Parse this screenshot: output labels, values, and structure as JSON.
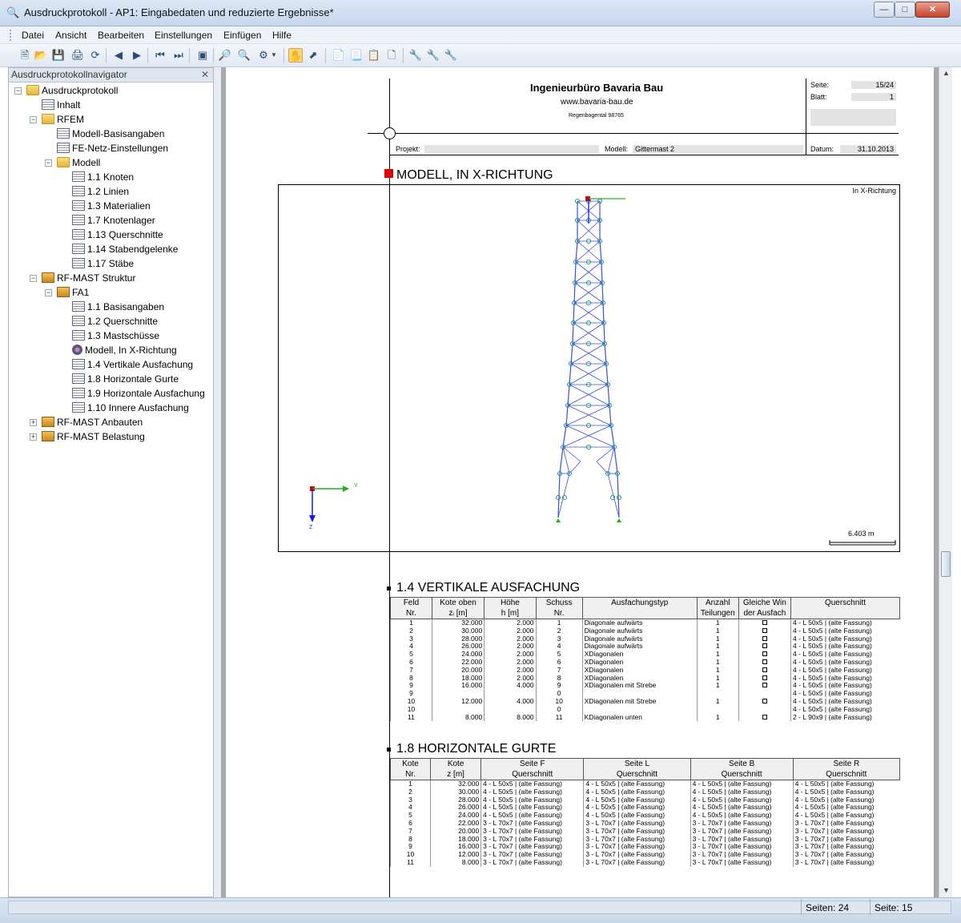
{
  "window": {
    "title": "Ausdruckprotokoll - AP1: Eingabedaten und reduzierte Ergebnisse*",
    "minimize": "—",
    "maximize": "□",
    "close": "✕"
  },
  "menu": [
    "Datei",
    "Ansicht",
    "Bearbeiten",
    "Einstellungen",
    "Einfügen",
    "Hilfe"
  ],
  "navigator": {
    "title": "Ausdruckprotokollnavigator",
    "close": "✕",
    "items": [
      {
        "label": "Ausdruckprotokoll",
        "icon": "folder-icon",
        "expander": "−"
      },
      {
        "label": "Inhalt",
        "icon": "table-icon"
      },
      {
        "label": "RFEM",
        "icon": "folder-icon",
        "expander": "−"
      },
      {
        "label": "Modell-Basisangaben",
        "icon": "table-icon"
      },
      {
        "label": "FE-Netz-Einstellungen",
        "icon": "table-icon"
      },
      {
        "label": "Modell",
        "icon": "folder-icon",
        "expander": "−"
      },
      {
        "label": "1.1 Knoten",
        "icon": "table-icon"
      },
      {
        "label": "1.2 Linien",
        "icon": "table-icon"
      },
      {
        "label": "1.3 Materialien",
        "icon": "table-icon"
      },
      {
        "label": "1.7 Knotenlager",
        "icon": "table-icon"
      },
      {
        "label": "1.13 Querschnitte",
        "icon": "table-icon"
      },
      {
        "label": "1.14 Stabendgelenke",
        "icon": "table-icon"
      },
      {
        "label": "1.17 Stäbe",
        "icon": "table-icon"
      },
      {
        "label": "RF-MAST Struktur",
        "icon": "mast-icon",
        "expander": "−"
      },
      {
        "label": "FA1",
        "icon": "mast-icon",
        "expander": "−"
      },
      {
        "label": "1.1 Basisangaben",
        "icon": "table-icon"
      },
      {
        "label": "1.2 Querschnitte",
        "icon": "table-icon"
      },
      {
        "label": "1.3 Mastschüsse",
        "icon": "table-icon"
      },
      {
        "label": "Modell, In X-Richtung",
        "icon": "model-icon"
      },
      {
        "label": "1.4 Vertikale Ausfachung",
        "icon": "table-icon"
      },
      {
        "label": "1.8 Horizontale Gurte",
        "icon": "table-icon"
      },
      {
        "label": "1.9 Horizontale Ausfachung",
        "icon": "table-icon"
      },
      {
        "label": "1.10 Innere Ausfachung",
        "icon": "table-icon"
      },
      {
        "label": "RF-MAST Anbauten",
        "icon": "mast-icon",
        "expander": "+"
      },
      {
        "label": "RF-MAST Belastung",
        "icon": "mast-icon",
        "expander": "+"
      }
    ]
  },
  "header": {
    "company": "Ingenieurbüro Bavaria Bau",
    "website": "www.bavaria-bau.de",
    "address": "Regenbogental 98765",
    "seite_label": "Seite:",
    "seite_value": "15/24",
    "blatt_label": "Blatt:",
    "blatt_value": "1",
    "projekt_label": "Projekt:",
    "modell_label": "Modell:",
    "modell_value": "Gittermast 2",
    "datum_label": "Datum:",
    "datum_value": "31.10.2013"
  },
  "model_section": {
    "title": "MODELL, IN X-RICHTUNG",
    "view_label": "In X-Richtung",
    "axis_y": "Y",
    "axis_z": "Z",
    "scale": "6.403 m"
  },
  "vertical": {
    "title": "1.4 VERTIKALE AUSFACHUNG",
    "headers": [
      [
        "Feld",
        "Nr."
      ],
      [
        "Kote oben",
        "zᵢ [m]"
      ],
      [
        "Höhe",
        "h [m]"
      ],
      [
        "Schuss",
        "Nr."
      ],
      [
        "Ausfachungstyp",
        ""
      ],
      [
        "Anzahl",
        "Teilungen"
      ],
      [
        "Gleiche Win",
        "der Ausfach"
      ],
      [
        "Querschnitt",
        ""
      ]
    ],
    "rows": [
      [
        "1",
        "32.000",
        "2.000",
        "1",
        "Diagonale aufwärts",
        "1",
        true,
        "4 - L 50x5 | (alte Fassung)"
      ],
      [
        "2",
        "30.000",
        "2.000",
        "2",
        "Diagonale aufwärts",
        "1",
        true,
        "4 - L 50x5 | (alte Fassung)"
      ],
      [
        "3",
        "28.000",
        "2.000",
        "3",
        "Diagonale aufwärts",
        "1",
        true,
        "4 - L 50x5 | (alte Fassung)"
      ],
      [
        "4",
        "26.000",
        "2.000",
        "4",
        "Diagonale aufwärts",
        "1",
        true,
        "4 - L 50x5 | (alte Fassung)"
      ],
      [
        "5",
        "24.000",
        "2.000",
        "5",
        "XDiagonalen",
        "1",
        true,
        "4 - L 50x5 | (alte Fassung)"
      ],
      [
        "6",
        "22.000",
        "2.000",
        "6",
        "XDiagonalen",
        "1",
        true,
        "4 - L 50x5 | (alte Fassung)"
      ],
      [
        "7",
        "20.000",
        "2.000",
        "7",
        "XDiagonalen",
        "1",
        true,
        "4 - L 50x5 | (alte Fassung)"
      ],
      [
        "8",
        "18.000",
        "2.000",
        "8",
        "XDiagonalen",
        "1",
        true,
        "4 - L 50x5 | (alte Fassung)"
      ],
      [
        "9",
        "16.000",
        "4.000",
        "9",
        "XDiagonalen mit Strebe",
        "1",
        true,
        "4 - L 50x5 | (alte Fassung)"
      ],
      [
        "9",
        "",
        "",
        "0",
        "",
        "",
        false,
        "4 - L 50x5 | (alte Fassung)"
      ],
      [
        "10",
        "12.000",
        "4.000",
        "10",
        "XDiagonalen mit Strebe",
        "1",
        true,
        "4 - L 50x5 | (alte Fassung)"
      ],
      [
        "10",
        "",
        "",
        "0",
        "",
        "",
        false,
        "4 - L 50x5 | (alte Fassung)"
      ],
      [
        "11",
        "8.000",
        "8.000",
        "11",
        "KDiagonalen unten",
        "1",
        true,
        "2 - L 90x9 | (alte Fassung)"
      ]
    ]
  },
  "horizontal": {
    "title": "1.8 HORIZONTALE GURTE",
    "headers": [
      [
        "Kote",
        "Nr."
      ],
      [
        "Kote",
        "z [m]"
      ],
      [
        "Seite F",
        "Querschnitt"
      ],
      [
        "Seite L",
        "Querschnitt"
      ],
      [
        "Seite B",
        "Querschnitt"
      ],
      [
        "Seite R",
        "Querschnitt"
      ]
    ],
    "rows": [
      [
        "1",
        "32.000",
        "4 - L 50x5 | (alte Fassung)",
        "4 - L 50x5 | (alte Fassung)",
        "4 - L 50x5 | (alte Fassung)",
        "4 - L 50x5 | (alte Fassung)"
      ],
      [
        "2",
        "30.000",
        "4 - L 50x5 | (alte Fassung)",
        "4 - L 50x5 | (alte Fassung)",
        "4 - L 50x5 | (alte Fassung)",
        "4 - L 50x5 | (alte Fassung)"
      ],
      [
        "3",
        "28.000",
        "4 - L 50x5 | (alte Fassung)",
        "4 - L 50x5 | (alte Fassung)",
        "4 - L 50x5 | (alte Fassung)",
        "4 - L 50x5 | (alte Fassung)"
      ],
      [
        "4",
        "26.000",
        "4 - L 50x5 | (alte Fassung)",
        "4 - L 50x5 | (alte Fassung)",
        "4 - L 50x5 | (alte Fassung)",
        "4 - L 50x5 | (alte Fassung)"
      ],
      [
        "5",
        "24.000",
        "4 - L 50x5 | (alte Fassung)",
        "4 - L 50x5 | (alte Fassung)",
        "4 - L 50x5 | (alte Fassung)",
        "4 - L 50x5 | (alte Fassung)"
      ],
      [
        "6",
        "22.000",
        "3 - L 70x7 | (alte Fassung)",
        "3 - L 70x7 | (alte Fassung)",
        "3 - L 70x7 | (alte Fassung)",
        "3 - L 70x7 | (alte Fassung)"
      ],
      [
        "7",
        "20.000",
        "3 - L 70x7 | (alte Fassung)",
        "3 - L 70x7 | (alte Fassung)",
        "3 - L 70x7 | (alte Fassung)",
        "3 - L 70x7 | (alte Fassung)"
      ],
      [
        "8",
        "18.000",
        "3 - L 70x7 | (alte Fassung)",
        "3 - L 70x7 | (alte Fassung)",
        "3 - L 70x7 | (alte Fassung)",
        "3 - L 70x7 | (alte Fassung)"
      ],
      [
        "9",
        "16.000",
        "3 - L 70x7 | (alte Fassung)",
        "3 - L 70x7 | (alte Fassung)",
        "3 - L 70x7 | (alte Fassung)",
        "3 - L 70x7 | (alte Fassung)"
      ],
      [
        "10",
        "12.000",
        "3 - L 70x7 | (alte Fassung)",
        "3 - L 70x7 | (alte Fassung)",
        "3 - L 70x7 | (alte Fassung)",
        "3 - L 70x7 | (alte Fassung)"
      ],
      [
        "11",
        "8.000",
        "3 - L 70x7 | (alte Fassung)",
        "3 - L 70x7 | (alte Fassung)",
        "3 - L 70x7 | (alte Fassung)",
        "3 - L 70x7 | (alte Fassung)"
      ]
    ]
  },
  "status": {
    "pages_total": "Seiten: 24",
    "page_current": "Seite: 15"
  },
  "colors": {
    "accent_red": "#e00000",
    "mast_blue": "#3a50d8",
    "node_teal": "#1f8f8a",
    "axis_green": "#20b020"
  }
}
